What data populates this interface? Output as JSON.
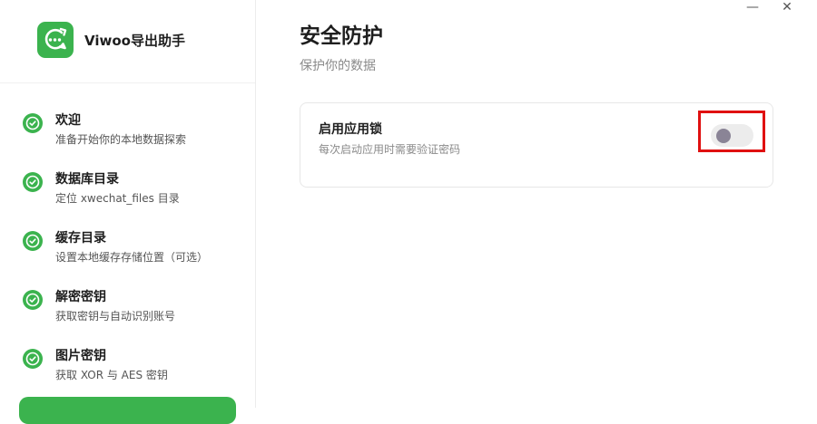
{
  "app": {
    "title": "Viwoo导出助手"
  },
  "window_controls": {
    "minimize": "—",
    "close": "✕"
  },
  "steps": [
    {
      "title": "欢迎",
      "desc": "准备开始你的本地数据探索",
      "status": "done",
      "icon": "check-circle-icon"
    },
    {
      "title": "数据库目录",
      "desc": "定位 xwechat_files 目录",
      "status": "done",
      "icon": "check-circle-icon"
    },
    {
      "title": "缓存目录",
      "desc": "设置本地缓存存储位置（可选）",
      "status": "done",
      "icon": "check-circle-icon"
    },
    {
      "title": "解密密钥",
      "desc": "获取密钥与自动识别账号",
      "status": "done",
      "icon": "check-circle-icon"
    },
    {
      "title": "图片密钥",
      "desc": "获取 XOR 与 AES 密钥",
      "status": "done",
      "icon": "check-circle-icon"
    }
  ],
  "page": {
    "title": "安全防护",
    "subtitle": "保护你的数据"
  },
  "setting": {
    "title": "启用应用锁",
    "desc": "每次启动应用时需要验证密码",
    "enabled": false
  },
  "colors": {
    "accent": "#3bb34e",
    "highlight": "#e01010",
    "toggle_off": "#ececec",
    "knob": "#8a8496"
  }
}
